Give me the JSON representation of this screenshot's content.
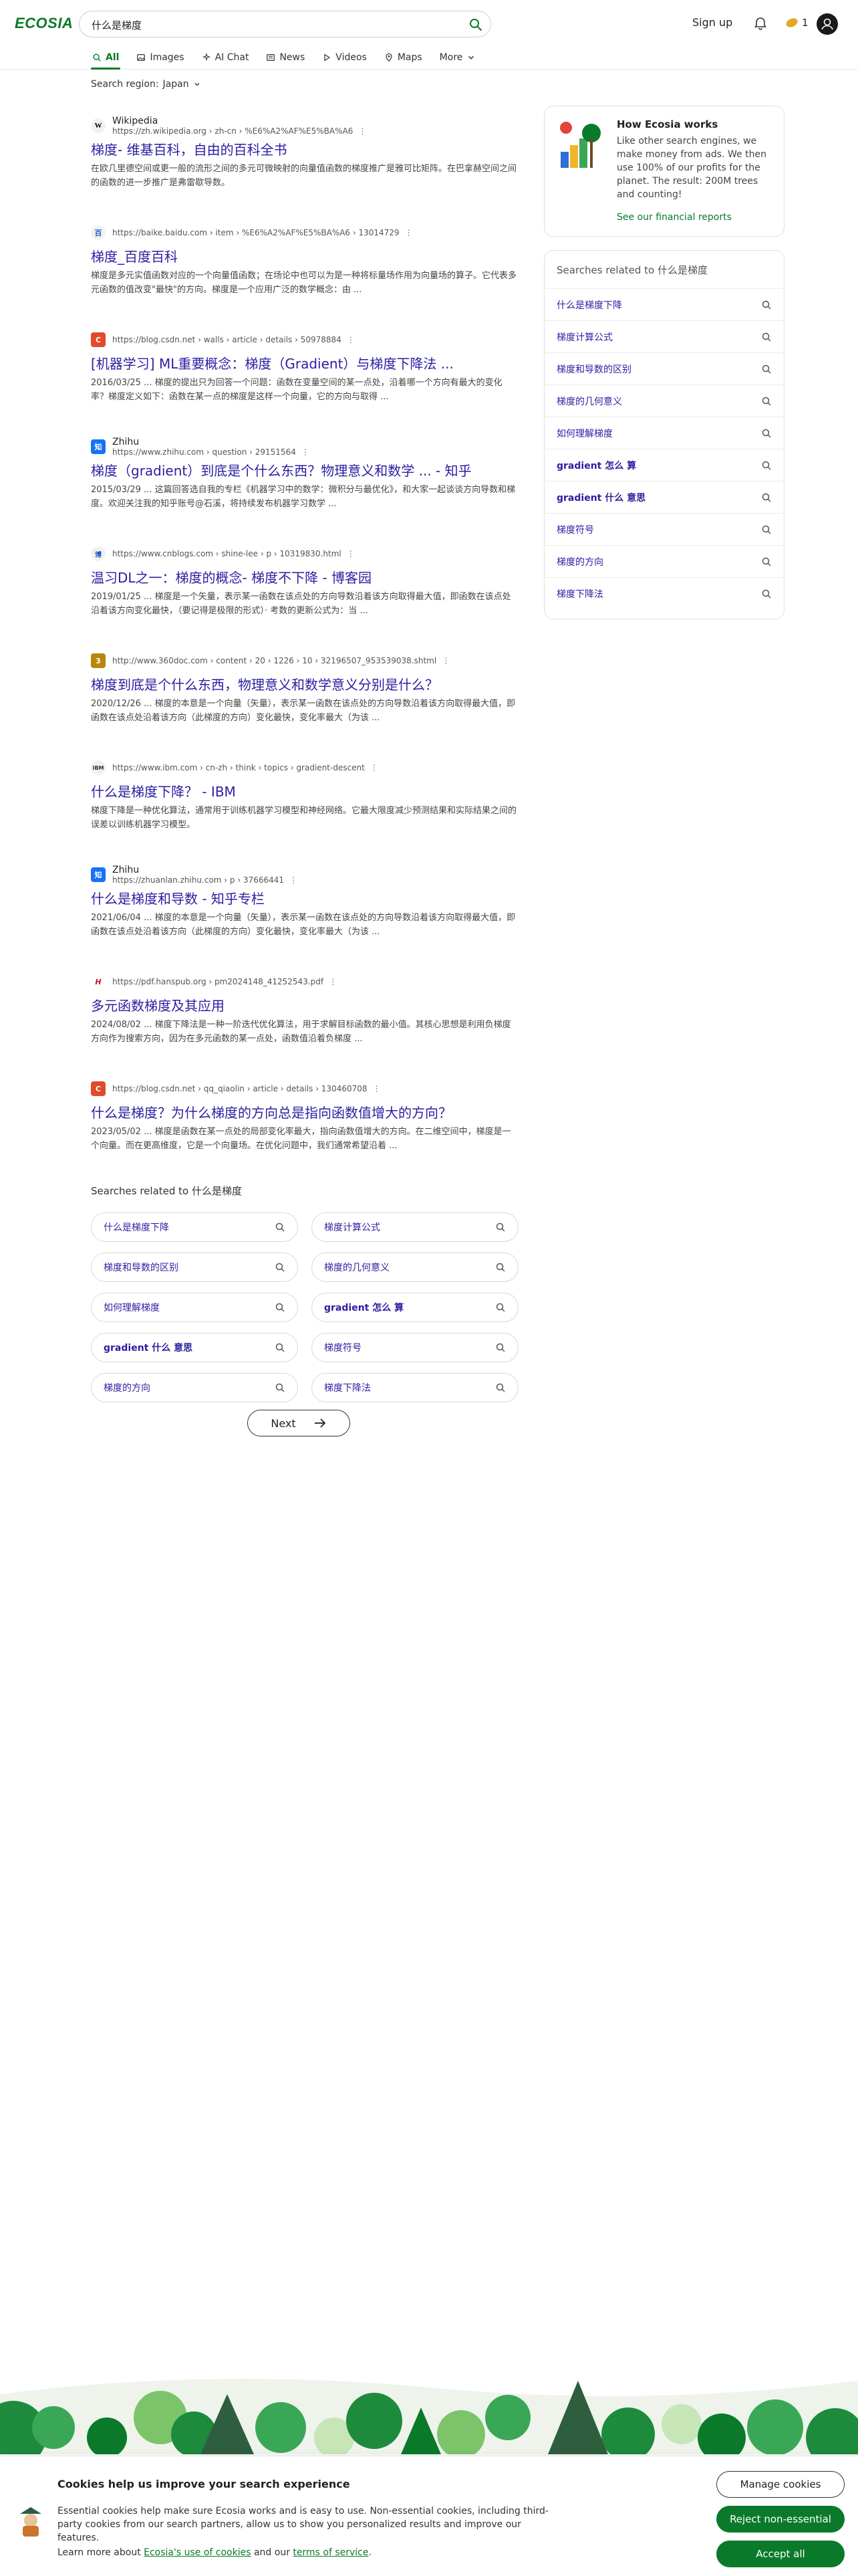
{
  "header": {
    "logo": "ECOSIA",
    "search_value": "什么是梯度",
    "signup": "Sign up",
    "coins": "1"
  },
  "tabs": [
    {
      "label": "All",
      "icon": "search-icon"
    },
    {
      "label": "Images",
      "icon": "image-icon"
    },
    {
      "label": "AI Chat",
      "icon": "ai-chat-icon"
    },
    {
      "label": "News",
      "icon": "news-icon"
    },
    {
      "label": "Videos",
      "icon": "play-icon"
    },
    {
      "label": "Maps",
      "icon": "map-pin-icon"
    },
    {
      "label": "More",
      "icon": "chevron-down-icon"
    }
  ],
  "region": {
    "label": "Search region:",
    "value": "Japan"
  },
  "results": [
    {
      "favicon": "W",
      "name": "Wikipedia",
      "url": "https://zh.wikipedia.org › zh-cn › %E6%A2%AF%E5%BA%A6",
      "title": "梯度- 维基百科，自由的百科全书",
      "snippet": "在欧几里德空间或更一般的流形之间的多元可微映射的向量值函数的梯度推广是雅可比矩阵。在巴拿赫空间之间的函数的进一步推广是弗雷歇导数。"
    },
    {
      "favicon": "百",
      "name": "",
      "url": "https://baike.baidu.com › item › %E6%A2%AF%E5%BA%A6 › 13014729",
      "title": "梯度_百度百科",
      "snippet": "梯度是多元实值函数对应的一个向量值函数；在场论中也可以为是一种将标量场作用为向量场的算子。它代表多元函数的值改变\"最快\"的方向。梯度是一个应用广泛的数学概念：由 ..."
    },
    {
      "favicon": "C",
      "name": "",
      "url": "https://blog.csdn.net › walls › article › details › 50978884",
      "title": "[机器学习] ML重要概念：梯度（Gradient）与梯度下降法 ...",
      "snippet": "2016/03/25 ... 梯度的提出只为回答一个问题：函数在变量空间的某一点处，沿着哪一个方向有最大的变化率？梯度定义如下：函数在某一点的梯度是这样一个向量，它的方向与取得 ..."
    },
    {
      "favicon": "知",
      "name": "Zhihu",
      "url": "https://www.zhihu.com › question › 29151564",
      "title": "梯度（gradient）到底是个什么东西？物理意义和数学 ... - 知乎",
      "snippet": "2015/03/29 ... 这篇回答选自我的专栏《机器学习中的数学：微积分与最优化》，和大家一起谈谈方向导数和梯度。欢迎关注我的知乎账号@石溪，将持续发布机器学习数学 ..."
    },
    {
      "favicon": "博",
      "name": "",
      "url": "https://www.cnblogs.com › shine-lee › p › 10319830.html",
      "title": "温习DL之一：梯度的概念- 梯度不下降 - 博客园",
      "snippet": "2019/01/25 ... 梯度是一个矢量，表示某一函数在该点处的方向导数沿着该方向取得最大值，即函数在该点处沿着该方向变化最快，（要记得是极限的形式）· 考数的更新公式为：当 ..."
    },
    {
      "favicon": "3",
      "name": "",
      "url": "http://www.360doc.com › content › 20 › 1226 › 10 › 32196507_953539038.shtml",
      "title": "梯度到底是个什么东西，物理意义和数学意义分别是什么？",
      "snippet": "2020/12/26 ... 梯度的本意是一个向量（矢量），表示某一函数在该点处的方向导数沿着该方向取得最大值，即函数在该点处沿着该方向（此梯度的方向）变化最快，变化率最大（为该 ..."
    },
    {
      "favicon": "IBM",
      "name": "",
      "url": "https://www.ibm.com › cn-zh › think › topics › gradient-descent",
      "title": "什么是梯度下降？ - IBM",
      "snippet": "梯度下降是一种优化算法，通常用于训练机器学习模型和神经网络。它最大限度减少预测结果和实际结果之间的误差以训练机器学习模型。"
    },
    {
      "favicon": "知",
      "name": "Zhihu",
      "url": "https://zhuanlan.zhihu.com › p › 37666441",
      "title": "什么是梯度和导数 - 知乎专栏",
      "snippet": "2021/06/04 ... 梯度的本意是一个向量（矢量），表示某一函数在该点处的方向导数沿着该方向取得最大值，即函数在该点处沿着该方向（此梯度的方向）变化最快，变化率最大（为该 ..."
    },
    {
      "favicon": "H",
      "name": "",
      "url": "https://pdf.hanspub.org › pm2024148_41252543.pdf",
      "title": "多元函数梯度及其应用",
      "snippet": "2024/08/02 ... 梯度下降法是一种一阶迭代优化算法，用于求解目标函数的最小值。其核心思想是利用负梯度方向作为搜索方向，因为在多元函数的某一点处，函数值沿着负梯度 ..."
    },
    {
      "favicon": "C",
      "name": "",
      "url": "https://blog.csdn.net › qq_qiaolin › article › details › 130460708",
      "title": "什么是梯度？为什么梯度的方向总是指向函数值增大的方向？",
      "snippet": "2023/05/02 ... 梯度是函数在某一点处的局部变化率最大，指向函数值增大的方向。在二维空间中，梯度是一个向量。而在更高维度，它是一个向量场。在优化问题中，我们通常希望沿着 ..."
    }
  ],
  "related": {
    "title": "Searches related to 什么是梯度",
    "items": [
      "什么是梯度下降",
      "梯度计算公式",
      "梯度和导数的区别",
      "梯度的几何意义",
      "如何理解梯度",
      "gradient 怎么 算",
      "gradient 什么 意思",
      "梯度符号",
      "梯度的方向",
      "梯度下降法"
    ]
  },
  "next": "Next",
  "sidebar": {
    "how_title": "How Ecosia works",
    "how_text": "Like other search engines, we make money from ads. We then use 100% of our profits for the planet. The result: 200M trees and counting!",
    "how_link": "See our financial reports",
    "related_title": "Searches related to 什么是梯度"
  },
  "cookie": {
    "title": "Cookies help us improve your search experience",
    "text": "Essential cookies help make sure Ecosia works and is easy to use. Non-essential cookies, including third-party cookies from our search partners, allow us to show you personalized results and improve our features.",
    "more_prefix": "Learn more about ",
    "more_link1": "Ecosia's use of cookies",
    "more_mid": " and our ",
    "more_link2": "terms of service",
    "more_suffix": ".",
    "manage": "Manage cookies",
    "reject": "Reject non-essential",
    "accept": "Accept all"
  },
  "colors": {
    "brand": "#0a7a2a",
    "link": "#2b1ea0"
  }
}
